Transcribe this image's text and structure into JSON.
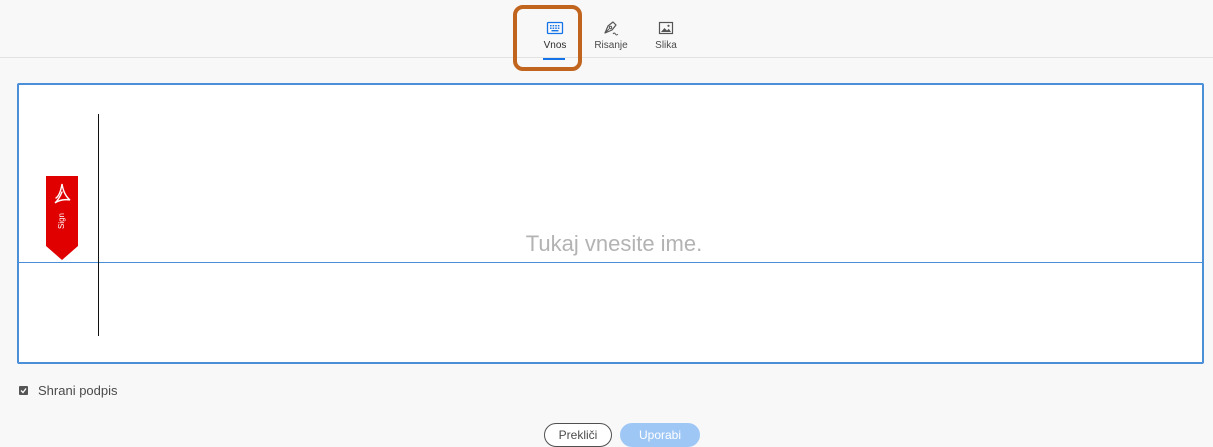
{
  "tabs": [
    {
      "label": "Vnos",
      "icon": "keyboard-icon",
      "active": true
    },
    {
      "label": "Risanje",
      "icon": "pen-icon",
      "active": false
    },
    {
      "label": "Slika",
      "icon": "image-icon",
      "active": false
    }
  ],
  "canvas": {
    "placeholder": "Tukaj vnesite ime.",
    "sign_badge": "Sign"
  },
  "save_signature": {
    "label": "Shrani podpis",
    "checked": true
  },
  "buttons": {
    "cancel": "Prekliči",
    "apply": "Uporabi"
  },
  "colors": {
    "accent": "#1473e6",
    "highlight": "#c0641e",
    "sign_badge": "#e00000",
    "apply_disabled": "#9fc7f5"
  }
}
